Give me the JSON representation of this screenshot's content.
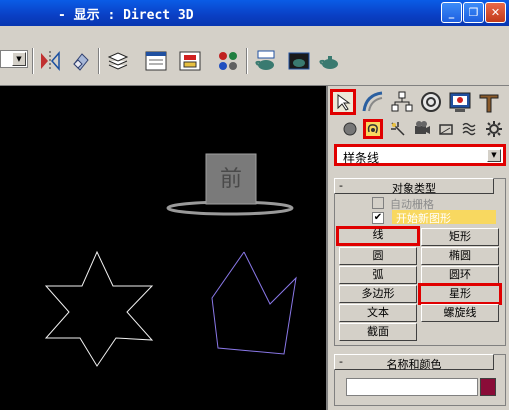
{
  "window": {
    "title": "- 显示 : Direct 3D"
  },
  "toolbar": {
    "icons": [
      "mirror-icon",
      "align-icon",
      "layer-manager-icon",
      "curve-editor-icon",
      "schematic-view-icon",
      "material-editor-icon",
      "render-scene-icon",
      "quick-render-icon",
      "render-last-icon"
    ]
  },
  "command_panel": {
    "tabs": [
      "create-tab",
      "modify-tab",
      "hierarchy-tab",
      "motion-tab",
      "display-tab",
      "utilities-tab"
    ],
    "subtabs": [
      "geometry-icon",
      "shapes-icon",
      "lights-icon",
      "cameras-icon",
      "helpers-icon",
      "spacewarps-icon",
      "systems-icon"
    ],
    "category": "样条线",
    "object_type": {
      "title": "对象类型",
      "auto_grid": "自动栅格",
      "start_new_shape": "开始新图形",
      "buttons": {
        "line": "线",
        "rectangle": "矩形",
        "circle": "圆",
        "ellipse": "椭圆",
        "arc": "弧",
        "donut": "圆环",
        "ngon": "多边形",
        "star": "星形",
        "text": "文本",
        "helix": "螺旋线",
        "section": "截面"
      }
    },
    "name_color": {
      "title": "名称和颜色",
      "name_value": "",
      "color": "#8a0c38"
    }
  },
  "viewport": {
    "background": "#000000",
    "gizmo_label": "前"
  }
}
